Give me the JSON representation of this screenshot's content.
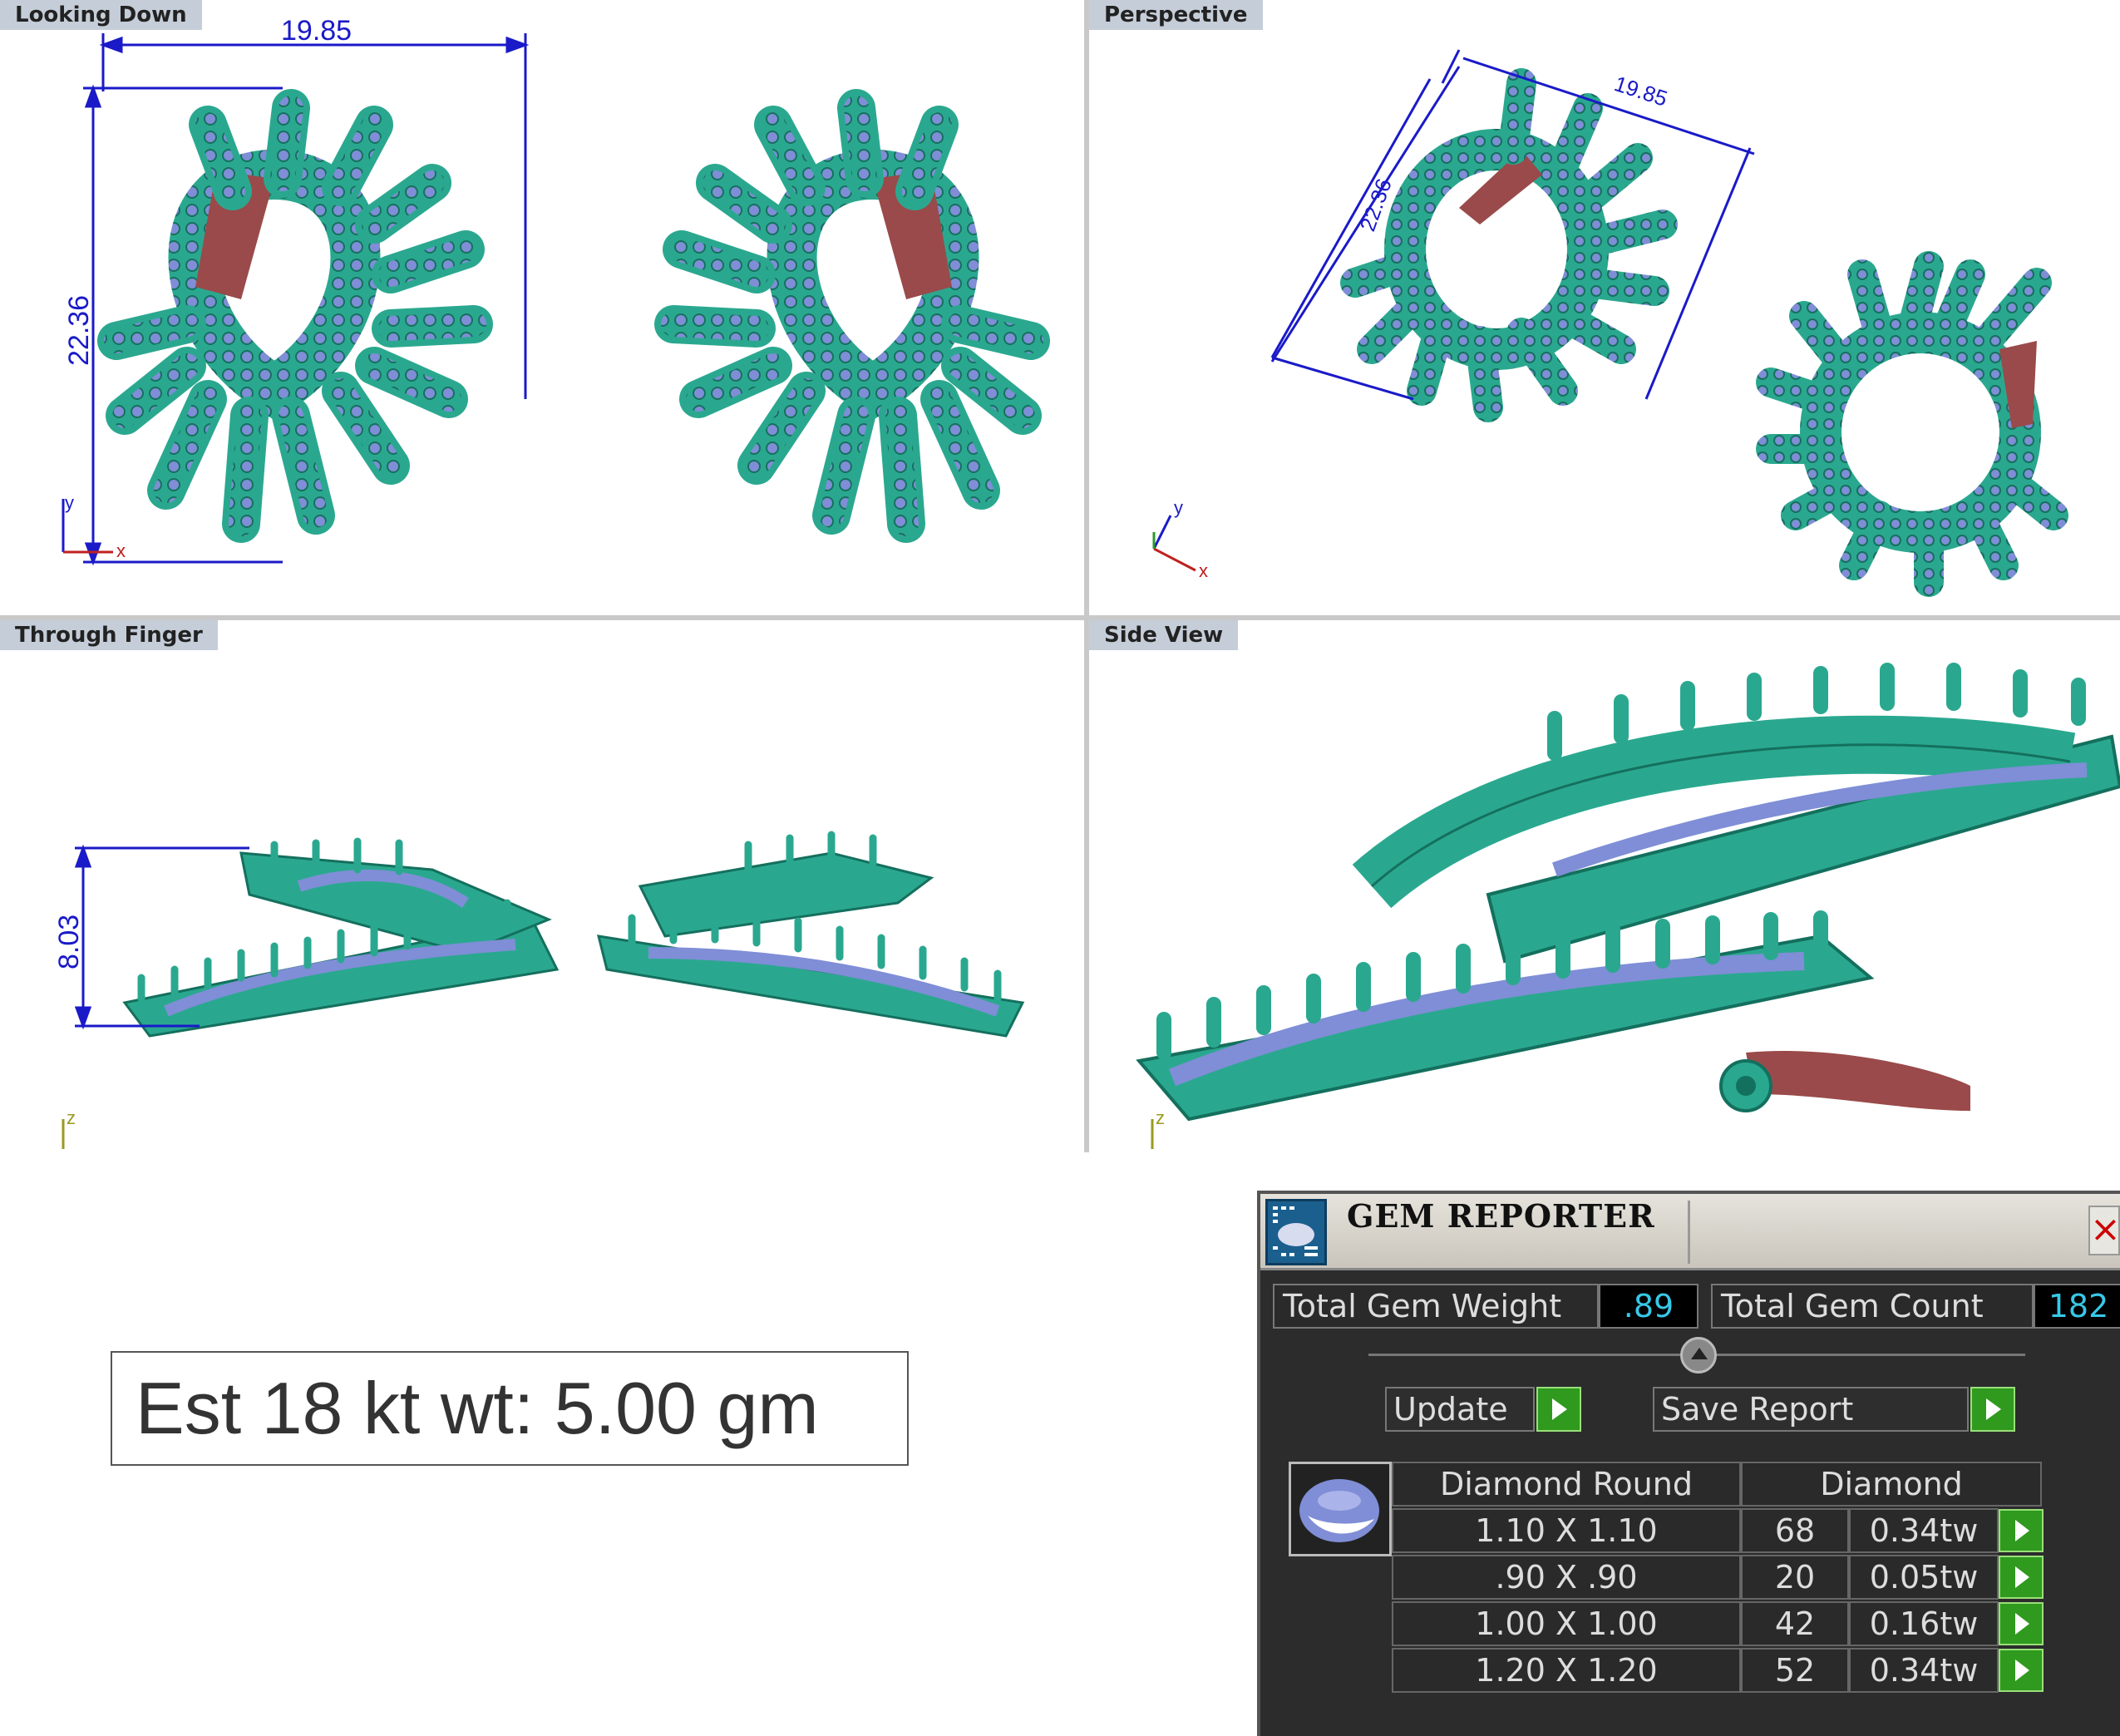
{
  "viewports": {
    "top_left": {
      "label": "Looking Down"
    },
    "top_right": {
      "label": "Perspective"
    },
    "bottom_left": {
      "label": "Through Finger"
    },
    "bottom_right": {
      "label": "Side View"
    }
  },
  "dimensions": {
    "width": "19.85",
    "height": "22.36",
    "depth": "8.03",
    "perspective_width": "19.85",
    "perspective_height": "22.36"
  },
  "axes": {
    "x": "x",
    "y": "y",
    "z": "z"
  },
  "weight_estimate": {
    "text": "Est 18 kt wt: 5.00 gm"
  },
  "gem_reporter": {
    "title": "GEM REPORTER",
    "close_glyph": "×",
    "total_weight_label": "Total Gem Weight",
    "total_weight_value": ".89",
    "total_count_label": "Total Gem Count",
    "total_count_value": "182",
    "update_label": "Update",
    "save_report_label": "Save Report",
    "table": {
      "header_shape": "Diamond Round",
      "header_type": "Diamond",
      "rows": [
        {
          "size": "1.10 X 1.10",
          "count": "68",
          "weight": "0.34tw"
        },
        {
          "size": ".90 X .90",
          "count": "20",
          "weight": "0.05tw"
        },
        {
          "size": "1.00 X 1.00",
          "count": "42",
          "weight": "0.16tw"
        },
        {
          "size": "1.20 X 1.20",
          "count": "52",
          "weight": "0.34tw"
        }
      ]
    }
  },
  "colors": {
    "metal": "#2aa88f",
    "metal_dark": "#14705e",
    "gem": "#7f8ed6",
    "post": "#9a4a4a",
    "dimension": "#1a1ac8",
    "viewport_label_bg": "#c5cdd8"
  }
}
